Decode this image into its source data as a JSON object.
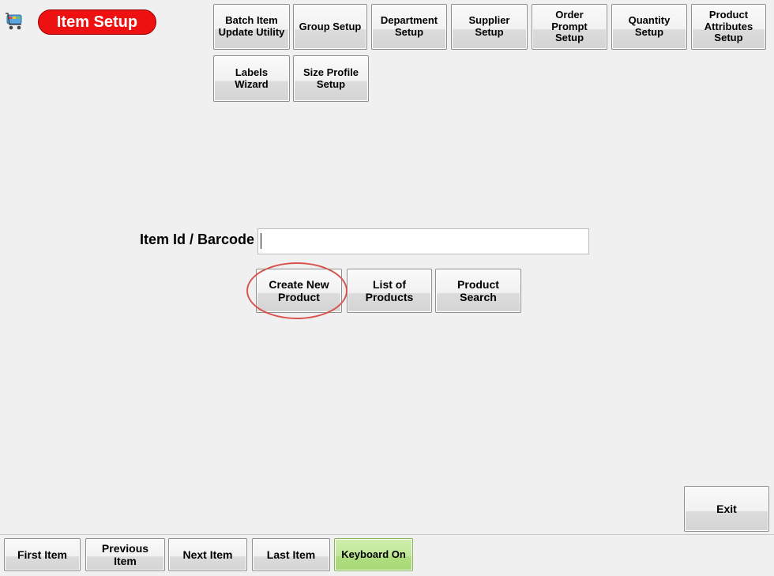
{
  "header": {
    "title": "Item Setup",
    "logo_icon": "shopping-cart-icon"
  },
  "toolbar": {
    "row1": [
      {
        "label": "Batch Item\nUpdate Utility"
      },
      {
        "label": "Group Setup"
      },
      {
        "label": "Department\nSetup"
      },
      {
        "label": "Supplier\nSetup"
      },
      {
        "label": "Order\nPrompt\nSetup"
      },
      {
        "label": "Quantity\nSetup"
      },
      {
        "label": "Product\nAttributes\nSetup"
      }
    ],
    "row2": [
      {
        "label": "Labels\nWizard"
      },
      {
        "label": "Size Profile\nSetup"
      }
    ]
  },
  "search": {
    "label": "Item Id / Barcode",
    "value": ""
  },
  "actions": {
    "create_new": "Create New\nProduct",
    "list": "List of\nProducts",
    "search": "Product\nSearch"
  },
  "exit_label": "Exit",
  "footer": {
    "first": "First Item",
    "previous": "Previous\nItem",
    "next": "Next Item",
    "last": "Last Item",
    "keyboard": "Keyboard On"
  },
  "colors": {
    "title_pill": "#ee1111",
    "keyboard_on": "#b5e287",
    "highlight_circle": "#d9534f"
  }
}
